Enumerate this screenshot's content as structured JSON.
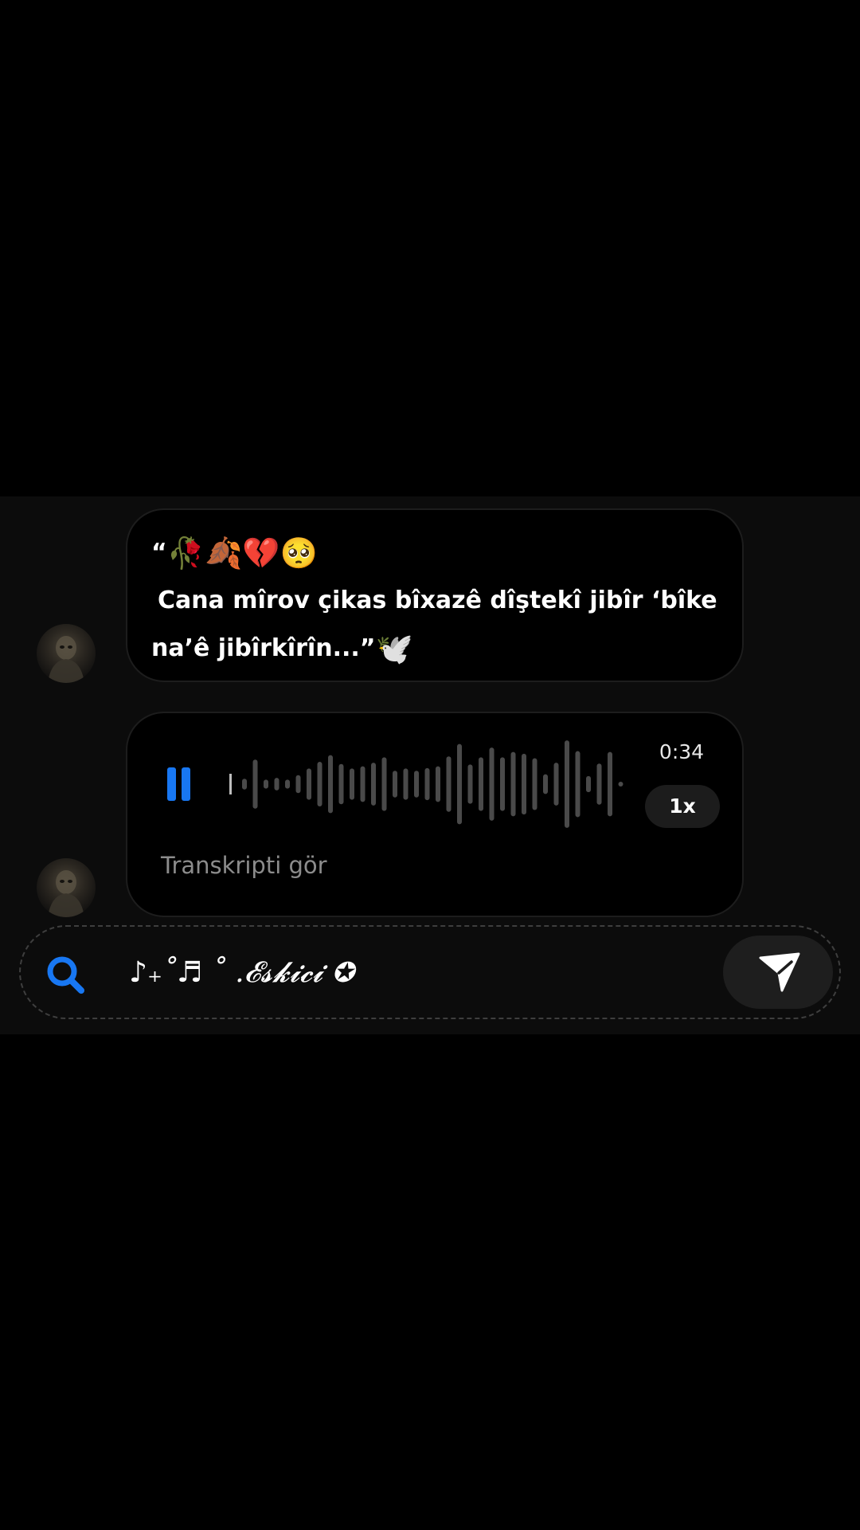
{
  "thread": {
    "text_message": {
      "line1_quote": "“",
      "line1_emojis": "🥀🍂💔🥺",
      "line2": "Cana mîrov çikas bîxazê dîştekî jibîr ‘bîke",
      "line3": "na’ê jibîrkîrîn...”",
      "line3_emoji": "🕊️"
    },
    "voice_message": {
      "duration": "0:34",
      "playback_speed": "1x",
      "state": "playing",
      "transcript_link": "Transkripti gör",
      "waveform_levels": [
        0.12,
        0.55,
        0.1,
        0.14,
        0.1,
        0.2,
        0.35,
        0.5,
        0.65,
        0.45,
        0.35,
        0.4,
        0.48,
        0.6,
        0.3,
        0.35,
        0.3,
        0.36,
        0.4,
        0.62,
        0.9,
        0.44,
        0.6,
        0.82,
        0.6,
        0.72,
        0.68,
        0.58,
        0.22,
        0.48,
        0.98,
        0.74,
        0.18,
        0.46,
        0.72,
        0.05
      ]
    }
  },
  "composer": {
    "recipient_name": "♪₊˚♬ ˚ .𝓔𝓼𝓴𝓲𝓬𝓲 ✪"
  },
  "colors": {
    "accent": "#1877f2",
    "waveform": "#4a4a4a",
    "bubble": "#000000",
    "panel": "#0c0c0c"
  }
}
